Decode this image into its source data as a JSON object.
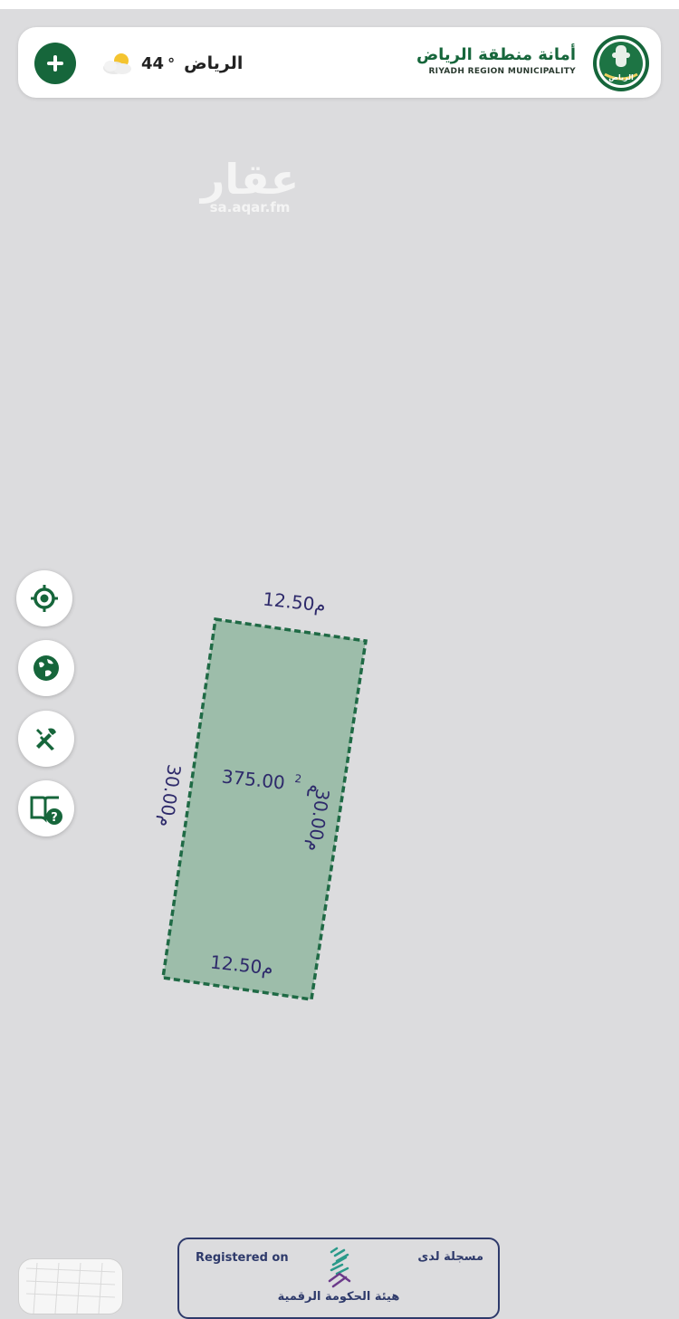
{
  "header": {
    "city": "الرياض",
    "temperature": "44",
    "degree_symbol": "°",
    "municipality_ar": "أمانة منطقة الرياض",
    "municipality_en": "RIYADH REGION MUNICIPALITY",
    "logo_text": "الرياض"
  },
  "watermark": {
    "ar": "عقار",
    "en": "sa.aqar.fm"
  },
  "tools": [
    {
      "icon": "locate-icon"
    },
    {
      "icon": "globe-icon"
    },
    {
      "icon": "tools-icon"
    },
    {
      "icon": "guide-help-icon"
    }
  ],
  "parcel": {
    "area_value": "375.00",
    "area_unit": "م",
    "area_superscript": "2",
    "top_length": "12.50م",
    "bottom_length": "12.50م",
    "left_length": "30.00م",
    "right_length": "30.00م"
  },
  "registration": {
    "registered_on_en": "Registered on",
    "registered_on_ar": "مسجلة لدى",
    "authority_ar": "هيئة الحكومة الرقمية"
  },
  "colors": {
    "brand_green": "#16663b",
    "parcel_fill": "#9dbdaa",
    "parcel_border": "#1f6a45",
    "label_color": "#2e2a6b",
    "map_background": "#dcdcde"
  }
}
